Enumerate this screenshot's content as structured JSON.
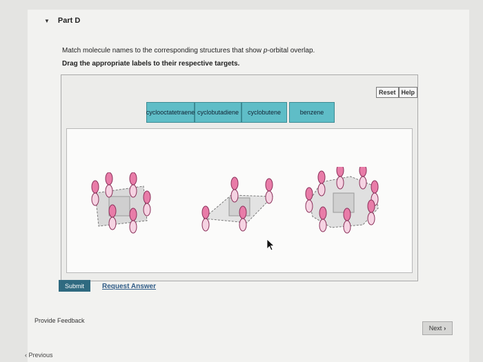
{
  "part": {
    "title": "Part D"
  },
  "instructions": {
    "prefix": "Match molecule names to the corresponding structures that show ",
    "p": "p",
    "suffix": "-orbital overlap.",
    "drag_note": "Drag the appropriate labels to their respective targets."
  },
  "toolbar": {
    "reset_label": "Reset",
    "help_label": "Help"
  },
  "labels": [
    {
      "text": "cyclooctatetraene"
    },
    {
      "text": "cyclobutadiene"
    },
    {
      "text": "cyclobutene"
    },
    {
      "text": "benzene"
    }
  ],
  "actions": {
    "submit_label": "Submit",
    "request_answer_label": "Request Answer",
    "feedback_label": "Provide Feedback",
    "next_label": "Next",
    "previous_label": "Previous"
  },
  "colors": {
    "label_fill": "#5fbdc7",
    "orbital_pink": "#e87ca8",
    "submit_fill": "#2f6a80",
    "link_blue": "#2f5b86"
  }
}
